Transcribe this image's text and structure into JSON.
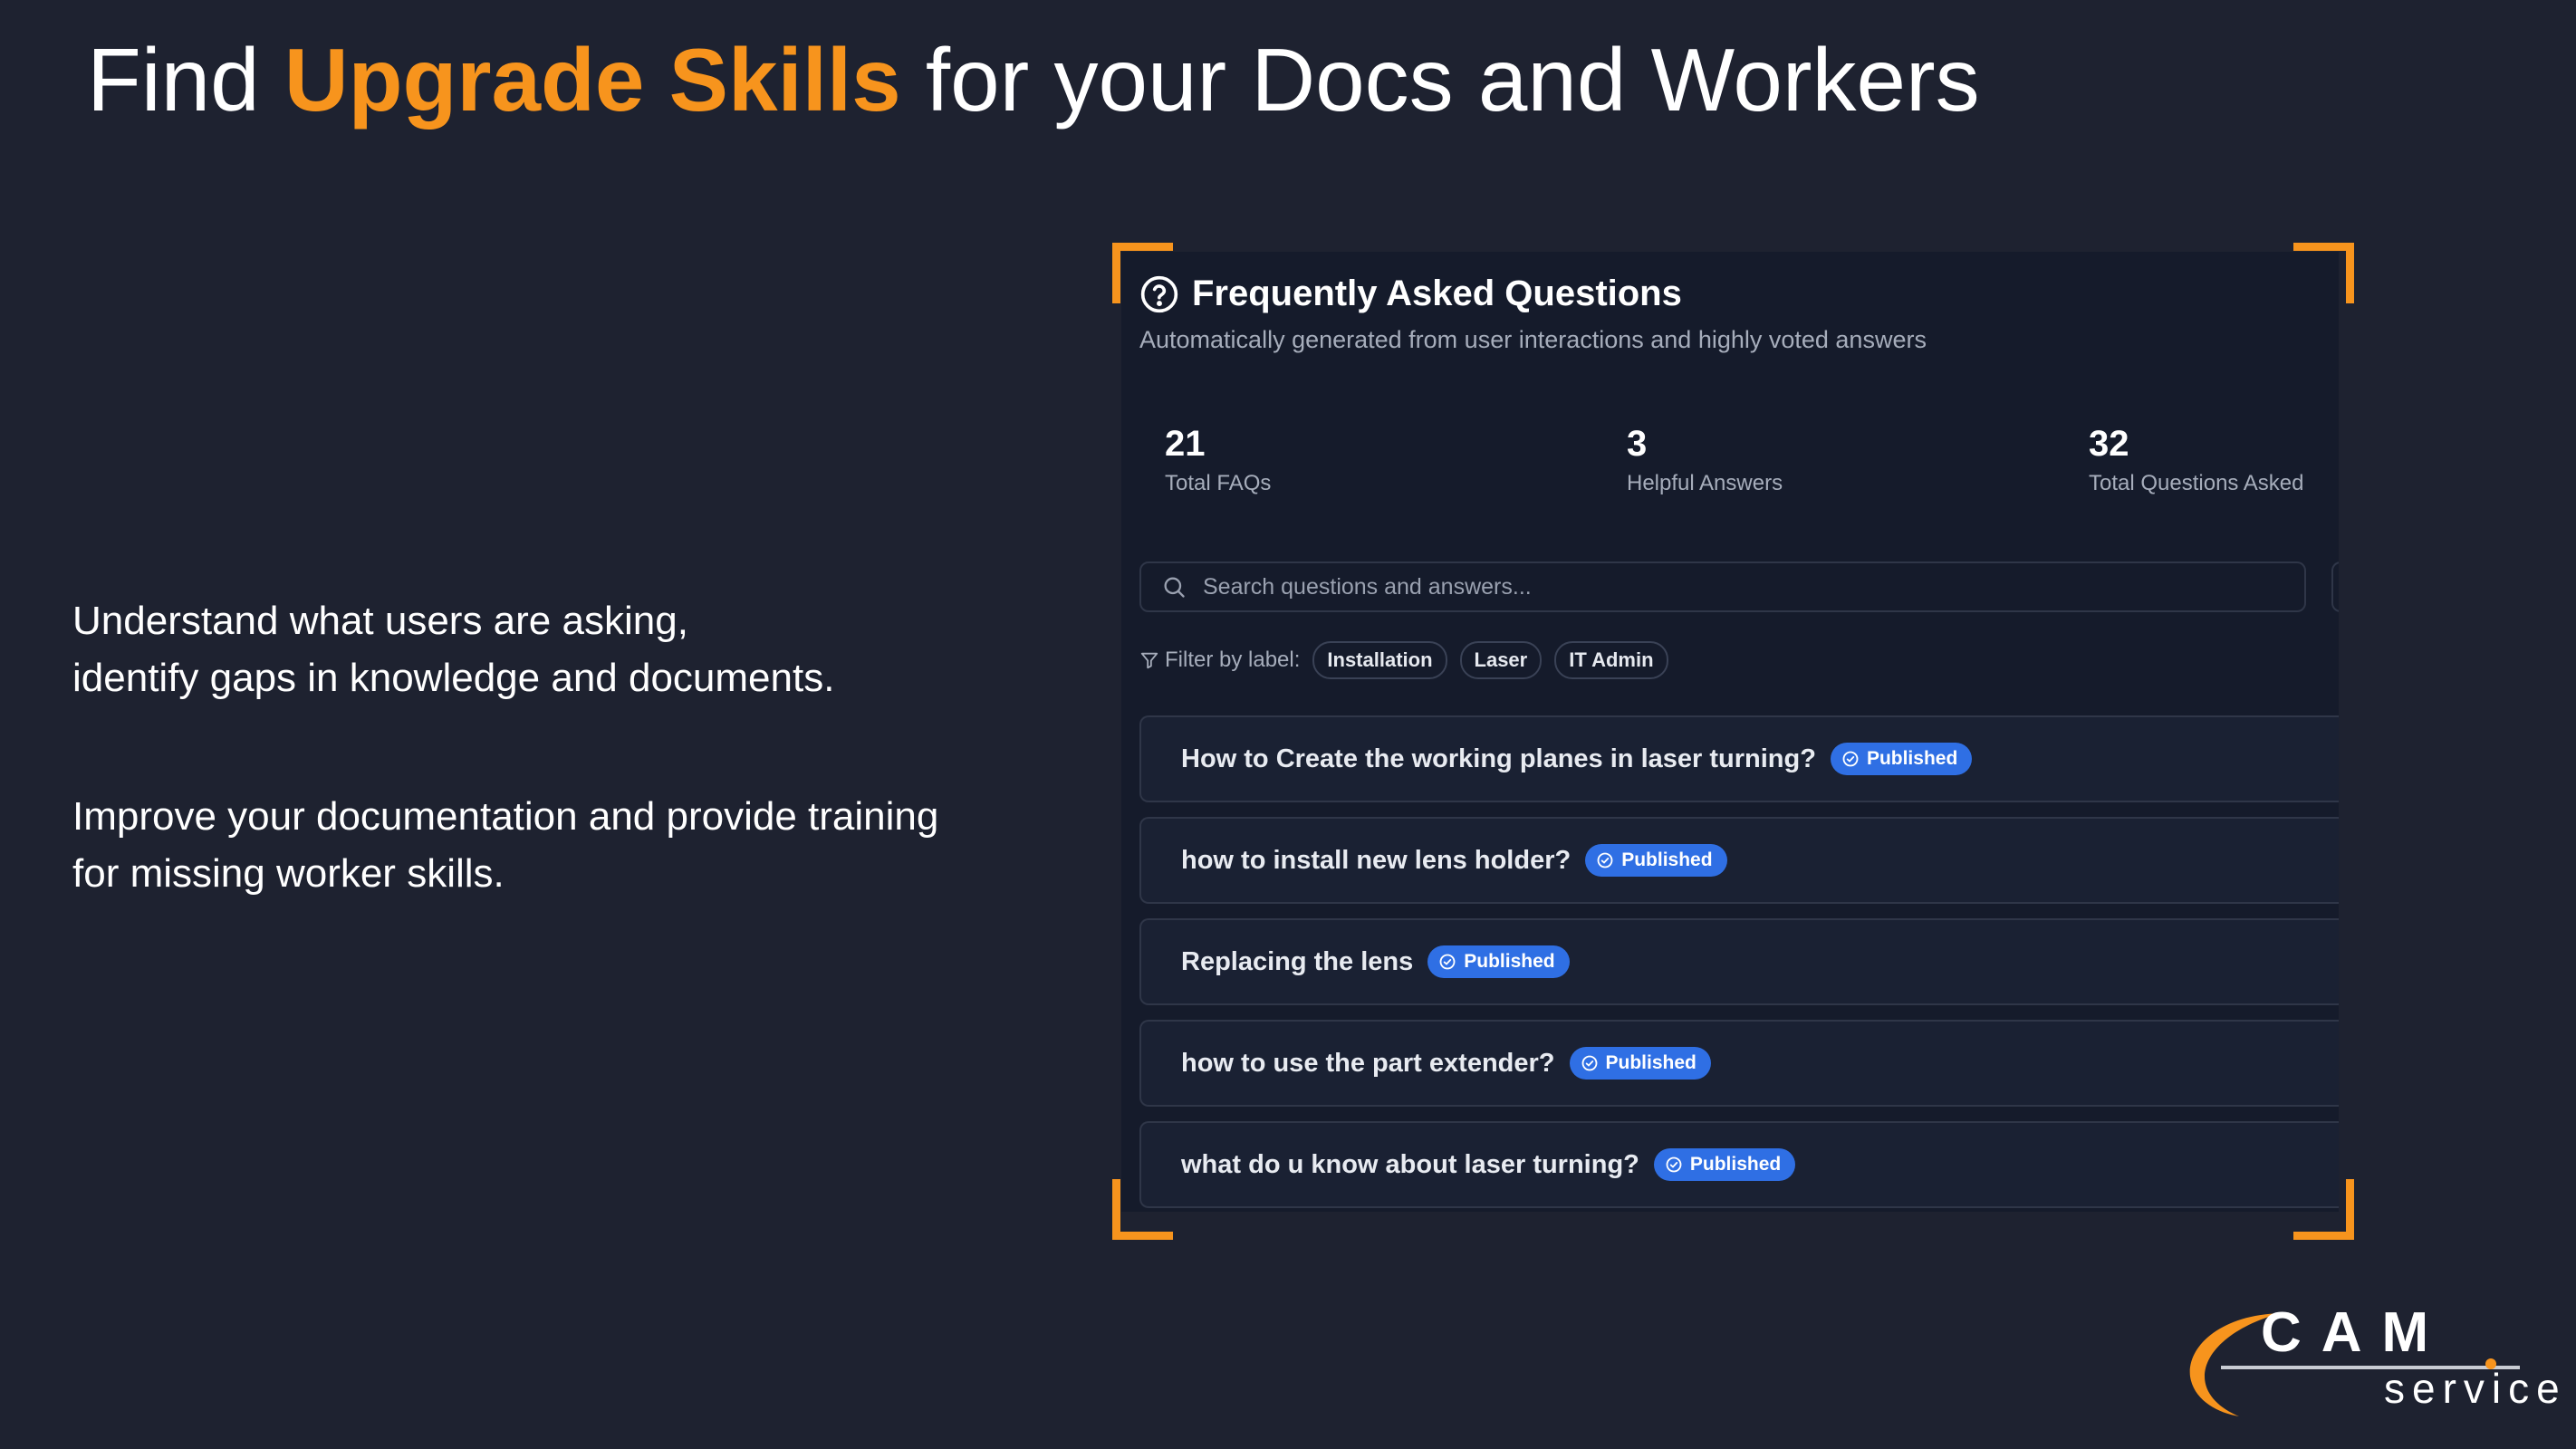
{
  "slide": {
    "title_prefix": "Find ",
    "title_highlight": "Upgrade Skills",
    "title_suffix": " for your Docs and Workers",
    "paragraph1": [
      "Understand what users are asking,",
      "identify gaps in knowledge and documents."
    ],
    "paragraph2": [
      "Improve your documentation and provide training",
      "for missing worker skills."
    ]
  },
  "faq": {
    "icon": "question-circle-icon",
    "title": "Frequently Asked Questions",
    "subtitle": "Automatically generated from user interactions and highly voted answers",
    "stats": [
      {
        "value": "21",
        "label": "Total FAQs"
      },
      {
        "value": "3",
        "label": "Helpful Answers"
      },
      {
        "value": "32",
        "label": "Total Questions Asked"
      }
    ],
    "search": {
      "placeholder": "Search questions and answers...",
      "icon": "search-icon"
    },
    "filter": {
      "label": "Filter by label:",
      "icon": "filter-icon",
      "chips": [
        "Installation",
        "Laser",
        "IT Admin"
      ]
    },
    "items": [
      {
        "question": "How to Create the working planes in laser turning?",
        "status": "Published"
      },
      {
        "question": "how to install new lens holder?",
        "status": "Published"
      },
      {
        "question": "Replacing the lens",
        "status": "Published"
      },
      {
        "question": "how to use the part extender?",
        "status": "Published"
      },
      {
        "question": "what do u know about laser turning?",
        "status": "Published"
      }
    ]
  },
  "logo": {
    "brand": "CAM",
    "tagline": "service"
  },
  "colors": {
    "background": "#1e2230",
    "accent": "#f7941d",
    "panel": "#151b2b",
    "badge": "#2f6fe4"
  }
}
